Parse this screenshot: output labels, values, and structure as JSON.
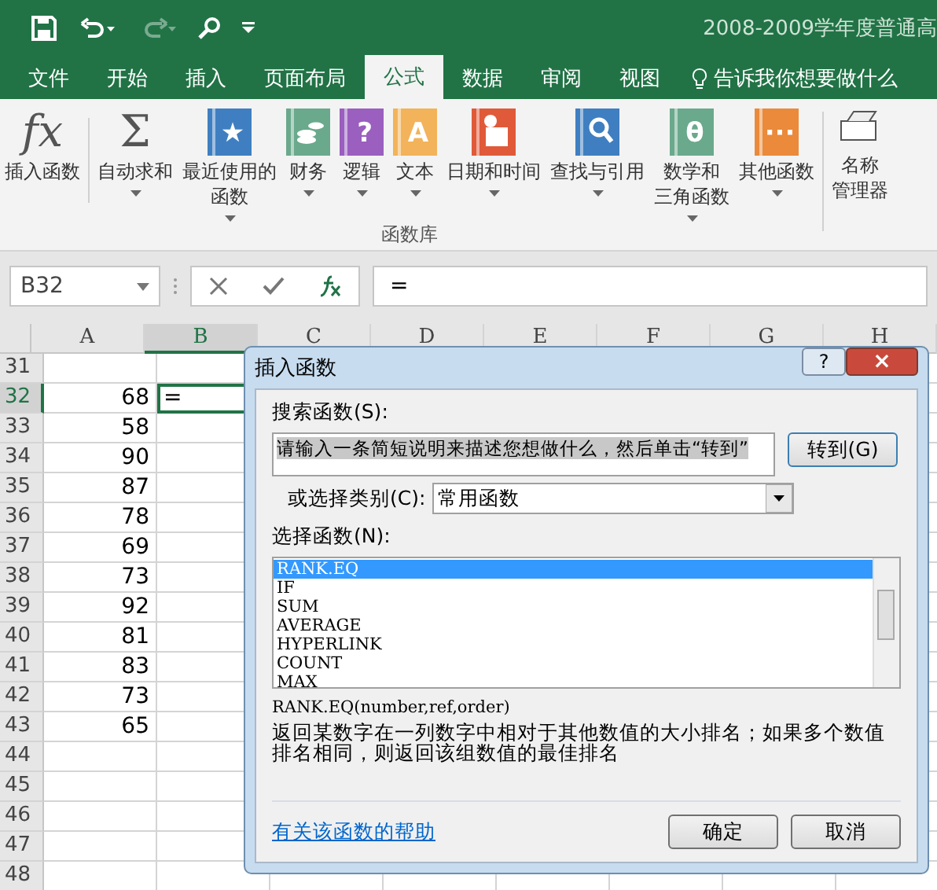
{
  "title_bar": {
    "title": "2008-2009学年度普通高",
    "quick_access": [
      {
        "kind": "save"
      },
      {
        "kind": "undo",
        "disabled": false
      },
      {
        "kind": "redo",
        "disabled": true
      },
      {
        "kind": "touch"
      },
      {
        "kind": "customize"
      }
    ]
  },
  "tabs": [
    {
      "label": "文件",
      "selected": false
    },
    {
      "label": "开始",
      "selected": false
    },
    {
      "label": "插入",
      "selected": false
    },
    {
      "label": "页面布局",
      "selected": false
    },
    {
      "label": "公式",
      "selected": true
    },
    {
      "label": "数据",
      "selected": false
    },
    {
      "label": "审阅",
      "selected": false
    },
    {
      "label": "视图",
      "selected": false
    }
  ],
  "tell_me": "告诉我你想要做什么",
  "ribbon": {
    "group_label": "函数库",
    "items": [
      {
        "lines": [
          "插入函数"
        ],
        "dropdown": false,
        "icon": {
          "kind": "glyph",
          "glyph": "fx"
        }
      },
      {
        "lines": [
          "自动求和"
        ],
        "dropdown": true,
        "icon": {
          "kind": "glyph",
          "glyph": "Σ"
        }
      },
      {
        "lines": [
          "最近使用的",
          "函数"
        ],
        "dropdown": true,
        "icon": {
          "kind": "book",
          "color": "#3f7fc1",
          "glyph": "★"
        }
      },
      {
        "lines": [
          "财务"
        ],
        "dropdown": true,
        "icon": {
          "kind": "coins",
          "color": "#6aa98c"
        }
      },
      {
        "lines": [
          "逻辑"
        ],
        "dropdown": true,
        "icon": {
          "kind": "book",
          "color": "#9a5fbf",
          "glyph": "?"
        }
      },
      {
        "lines": [
          "文本"
        ],
        "dropdown": true,
        "icon": {
          "kind": "book",
          "color": "#f2b35a",
          "glyph": "A"
        }
      },
      {
        "lines": [
          "日期和时间"
        ],
        "dropdown": true,
        "icon": {
          "kind": "calendar",
          "color": "#e05a3a"
        }
      },
      {
        "lines": [
          "查找与引用"
        ],
        "dropdown": true,
        "icon": {
          "kind": "search",
          "color": "#3f7fc1"
        }
      },
      {
        "lines": [
          "数学和",
          "三角函数"
        ],
        "dropdown": true,
        "icon": {
          "kind": "book",
          "color": "#6aa98c",
          "glyph": "θ"
        }
      },
      {
        "lines": [
          "其他函数"
        ],
        "dropdown": true,
        "icon": {
          "kind": "book",
          "color": "#ea8a3a",
          "glyph": "···"
        }
      }
    ],
    "extra": {
      "lines": [
        "名称",
        "管理器"
      ]
    }
  },
  "formula_bar": {
    "name_box": "B32",
    "formula": "="
  },
  "sheet": {
    "columns": [
      {
        "label": "A",
        "selected": false
      },
      {
        "label": "B",
        "selected": true
      },
      {
        "label": "C",
        "selected": false
      },
      {
        "label": "D",
        "selected": false
      },
      {
        "label": "E",
        "selected": false
      },
      {
        "label": "F",
        "selected": false
      },
      {
        "label": "G",
        "selected": false
      },
      {
        "label": "H",
        "selected": false
      }
    ],
    "rows": [
      {
        "number": "31",
        "selected": false,
        "a": ""
      },
      {
        "number": "32",
        "selected": true,
        "a": "68",
        "b": "="
      },
      {
        "number": "33",
        "selected": false,
        "a": "58"
      },
      {
        "number": "34",
        "selected": false,
        "a": "90"
      },
      {
        "number": "35",
        "selected": false,
        "a": "87"
      },
      {
        "number": "36",
        "selected": false,
        "a": "78"
      },
      {
        "number": "37",
        "selected": false,
        "a": "69"
      },
      {
        "number": "38",
        "selected": false,
        "a": "73"
      },
      {
        "number": "39",
        "selected": false,
        "a": "92"
      },
      {
        "number": "40",
        "selected": false,
        "a": "81"
      },
      {
        "number": "41",
        "selected": false,
        "a": "83"
      },
      {
        "number": "42",
        "selected": false,
        "a": "73"
      },
      {
        "number": "43",
        "selected": false,
        "a": "65"
      },
      {
        "number": "44",
        "selected": false,
        "a": ""
      },
      {
        "number": "45",
        "selected": false,
        "a": ""
      },
      {
        "number": "46",
        "selected": false,
        "a": ""
      },
      {
        "number": "47",
        "selected": false,
        "a": ""
      },
      {
        "number": "48",
        "selected": false,
        "a": ""
      }
    ]
  },
  "dialog": {
    "title": "插入函数",
    "help": "?",
    "close": "×",
    "search_label": "搜索函数(S):",
    "search_value": "请输入一条简短说明来描述您想做什么，然后单击“转到”",
    "go_button": "转到(G)",
    "category_label": "或选择类别(C):",
    "category_value": "常用函数",
    "list_label": "选择函数(N):",
    "functions": [
      {
        "name": "RANK.EQ",
        "selected": true
      },
      {
        "name": "IF",
        "selected": false
      },
      {
        "name": "SUM",
        "selected": false
      },
      {
        "name": "AVERAGE",
        "selected": false
      },
      {
        "name": "HYPERLINK",
        "selected": false
      },
      {
        "name": "COUNT",
        "selected": false
      },
      {
        "name": "MAX",
        "selected": false
      }
    ],
    "signature": "RANK.EQ(number,ref,order)",
    "description": "返回某数字在一列数字中相对于其他数值的大小排名；如果多个数值排名相同，则返回该组数值的最佳排名",
    "help_link": "有关该函数的帮助",
    "ok": "确定",
    "cancel": "取消"
  }
}
